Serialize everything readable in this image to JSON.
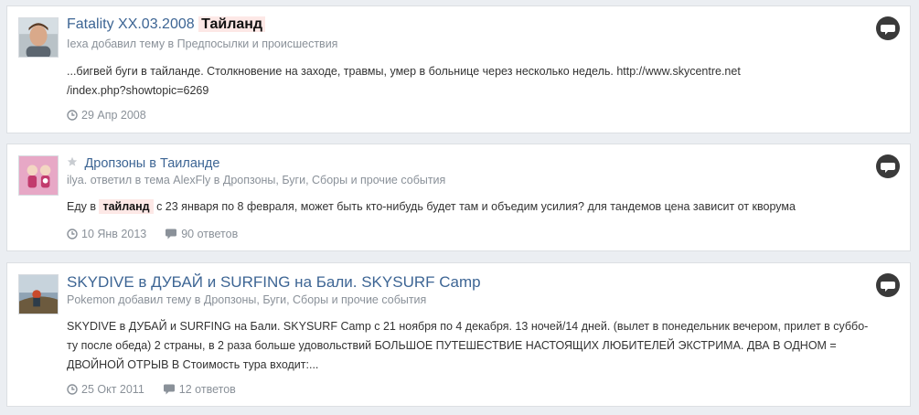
{
  "results": [
    {
      "title_prefix": "Fatality XX.03.2008 ",
      "title_highlight": "Тайланд",
      "meta": "Iexa добавил тему в Предпосылки и происшествия",
      "snippet_line1": "...бигвей буги в тайланде. Столкновение на заходе, травмы, умер в больнице через несколько недель. http://www.skycentre.net",
      "snippet_line2": "/index.php?showtopic=6269",
      "date": "29 Апр 2008"
    },
    {
      "title": "Дропзоны в Таиланде",
      "meta": "ilya. ответил в тема AlexFly в Дропзоны, Буги, Сборы и прочие события",
      "snippet_before": "Еду в ",
      "snippet_highlight": "тайланд",
      "snippet_after": " с 23 января по 8 февраля, может быть кто-нибудь будет там и объедим усилия? для тандемов цена зависит от кворума",
      "date": "10 Янв 2013",
      "replies": "90 ответов"
    },
    {
      "title": "SKYDIVE в ДУБАЙ и SURFING на Бали. SKYSURF Camp",
      "meta": "Pokemon добавил тему в Дропзоны, Буги, Сборы и прочие события",
      "snippet_line1": "SKYDIVE в ДУБАЙ и SURFING на Бали. SKYSURF Camp с 21 ноября по 4 декабря. 13 ночей/14 дней. (вылет в понедельник вечером, прилет в суббо-",
      "snippet_line2": "ту после обеда) 2 страны, в 2 раза больше удовольствий БОЛЬШОЕ ПУТЕШЕСТВИЕ НАСТОЯЩИХ ЛЮБИТЕЛЕЙ ЭКСТРИМА. ДВА В ОДНОМ =",
      "snippet_line3": "ДВОЙНОЙ ОТРЫВ В Стоимость тура входит:...",
      "date": "25 Окт 2011",
      "replies": "12 ответов"
    }
  ],
  "icons": {
    "chat": "chat-bubble-icon",
    "clock": "clock-icon",
    "comment": "comment-icon",
    "star": "star-icon"
  },
  "colors": {
    "link": "#3d6594",
    "highlight_bg": "#fde8e6",
    "meta": "#8a9199"
  }
}
